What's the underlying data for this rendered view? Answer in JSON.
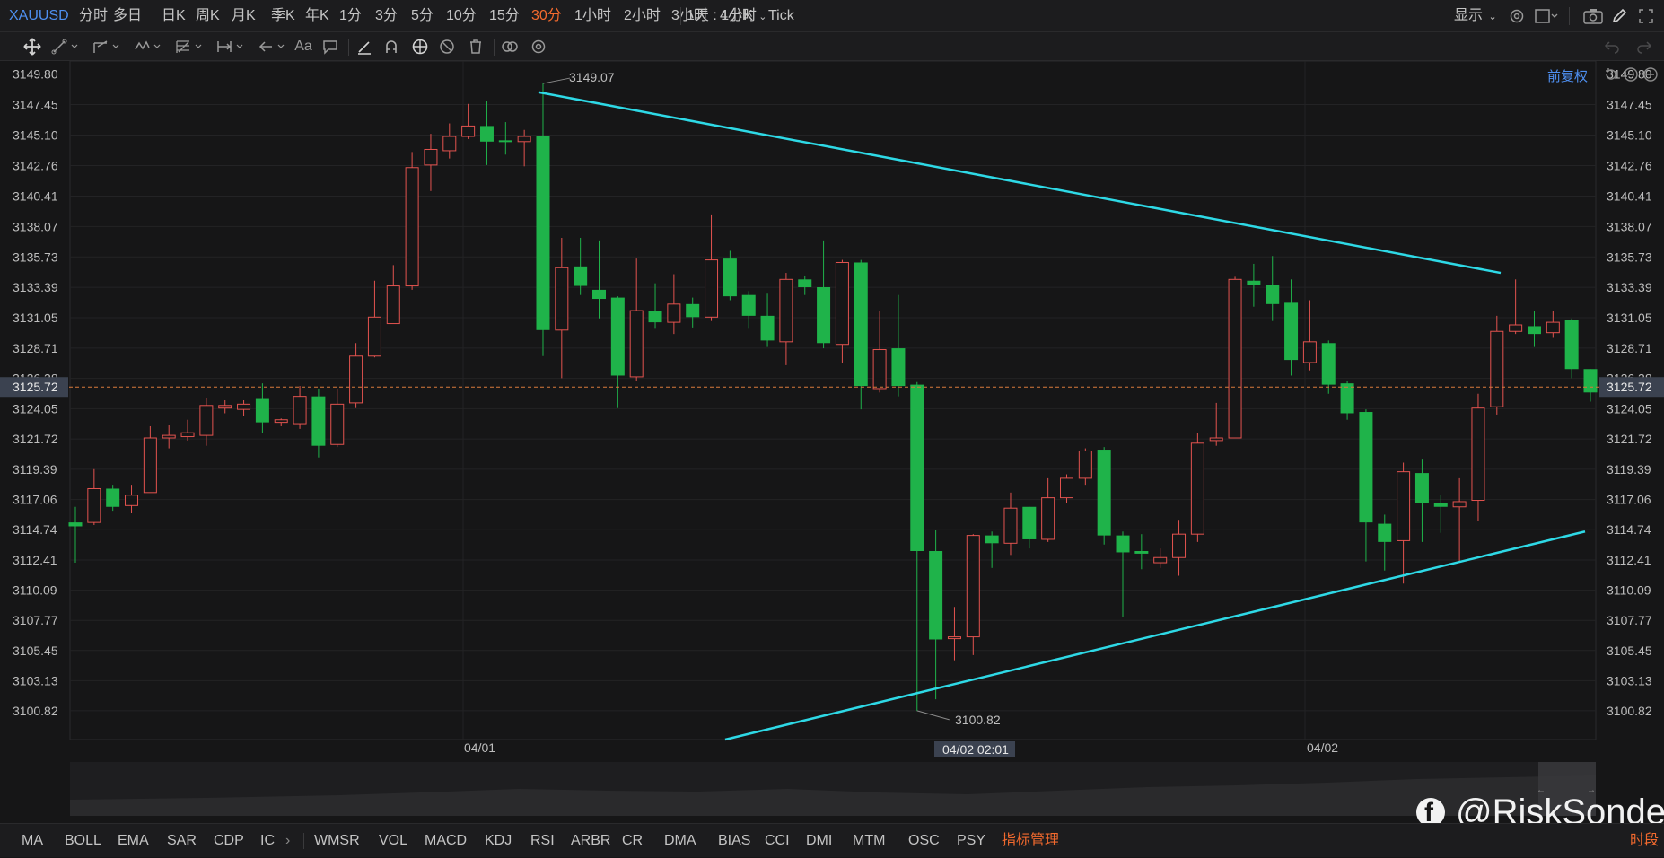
{
  "toolbar": {
    "symbol": "XAUUSD",
    "periods": [
      "分时",
      "多日",
      "日K",
      "周K",
      "月K",
      "季K",
      "年K",
      "1分",
      "3分",
      "5分",
      "10分",
      "15分",
      "30分",
      "1小时",
      "2小时",
      "3小时",
      "4小时",
      "Tick"
    ],
    "active_period": "30分",
    "combo": "1天 : 1分K",
    "display_label": "显示"
  },
  "drawing_tools": [
    "move-icon",
    "line-icon",
    "channel-icon",
    "wave-icon",
    "fib-icon",
    "measure-icon",
    "arrow-icon",
    "text-icon",
    "comment-icon",
    "pen-icon",
    "magnet-icon",
    "lock-icon",
    "hide-icon",
    "trash-icon",
    "link-icon",
    "settings-icon"
  ],
  "chart": {
    "fuquan_label": "前复权",
    "current_price_label": "3125.72"
  },
  "chart_data": {
    "type": "candlestick",
    "symbol": "XAUUSD",
    "timeframe": "30分",
    "y_ticks": [
      "3149.80",
      "3147.45",
      "3145.10",
      "3142.76",
      "3140.41",
      "3138.07",
      "3135.73",
      "3133.39",
      "3131.05",
      "3128.71",
      "3126.38",
      "3124.05",
      "3121.72",
      "3119.39",
      "3117.06",
      "3114.74",
      "3112.41",
      "3110.09",
      "3107.77",
      "3105.45",
      "3103.13",
      "3100.82"
    ],
    "ylim": [
      3098.6,
      3150.8
    ],
    "x_labels": [
      "04/01",
      "04/02"
    ],
    "crosshair_label": "04/02 02:01",
    "high_marker": "3149.07",
    "low_marker": "3100.82",
    "current_price": 3125.72,
    "candles": [
      [
        3115.3,
        3115.0,
        3116.5,
        3112.2
      ],
      [
        3115.3,
        3117.9,
        3119.4,
        3115.1
      ],
      [
        3117.9,
        3116.5,
        3118.2,
        3116.2
      ],
      [
        3116.6,
        3117.4,
        3118.2,
        3116.0
      ],
      [
        3117.6,
        3121.8,
        3122.7,
        3117.6
      ],
      [
        3121.8,
        3122.0,
        3122.8,
        3121.0
      ],
      [
        3121.9,
        3122.2,
        3123.2,
        3121.6
      ],
      [
        3122.0,
        3124.3,
        3124.9,
        3121.2
      ],
      [
        3124.1,
        3124.3,
        3124.7,
        3123.7
      ],
      [
        3124.0,
        3124.4,
        3124.7,
        3123.5
      ],
      [
        3124.8,
        3123.0,
        3126.0,
        3122.2
      ],
      [
        3123.0,
        3123.2,
        3123.3,
        3122.7
      ],
      [
        3122.9,
        3125.0,
        3125.8,
        3122.5
      ],
      [
        3125.0,
        3121.2,
        3125.6,
        3120.3
      ],
      [
        3121.3,
        3124.4,
        3125.6,
        3121.1
      ],
      [
        3124.5,
        3128.1,
        3129.1,
        3124.1
      ],
      [
        3128.1,
        3131.1,
        3133.9,
        3128.0
      ],
      [
        3130.6,
        3133.5,
        3135.1,
        3130.6
      ],
      [
        3133.5,
        3142.6,
        3143.8,
        3133.2
      ],
      [
        3142.8,
        3144.0,
        3145.2,
        3140.8
      ],
      [
        3143.9,
        3145.0,
        3146.0,
        3143.3
      ],
      [
        3145.0,
        3145.8,
        3147.5,
        3144.8
      ],
      [
        3145.8,
        3144.6,
        3147.7,
        3142.8
      ],
      [
        3144.7,
        3144.6,
        3146.1,
        3143.6
      ],
      [
        3144.6,
        3145.0,
        3145.5,
        3142.7
      ],
      [
        3145.0,
        3130.1,
        3149.1,
        3128.1
      ],
      [
        3130.1,
        3134.9,
        3137.2,
        3126.4
      ],
      [
        3135.0,
        3133.5,
        3137.2,
        3132.8
      ],
      [
        3133.2,
        3132.5,
        3137.0,
        3131.0
      ],
      [
        3132.6,
        3126.6,
        3132.7,
        3124.1
      ],
      [
        3126.5,
        3131.6,
        3135.6,
        3126.2
      ],
      [
        3131.6,
        3130.7,
        3133.7,
        3130.2
      ],
      [
        3130.7,
        3132.1,
        3134.4,
        3129.8
      ],
      [
        3132.1,
        3131.1,
        3132.6,
        3130.3
      ],
      [
        3131.1,
        3135.5,
        3139.0,
        3130.8
      ],
      [
        3135.6,
        3132.7,
        3136.2,
        3132.4
      ],
      [
        3132.8,
        3131.2,
        3133.1,
        3130.2
      ],
      [
        3131.2,
        3129.3,
        3132.9,
        3128.8
      ],
      [
        3129.2,
        3134.0,
        3134.5,
        3127.4
      ],
      [
        3134.0,
        3133.4,
        3134.3,
        3132.8
      ],
      [
        3133.4,
        3129.1,
        3137.0,
        3128.7
      ],
      [
        3129.0,
        3135.3,
        3135.5,
        3127.6
      ],
      [
        3135.3,
        3125.8,
        3135.5,
        3124.0
      ],
      [
        3125.6,
        3128.6,
        3131.6,
        3125.3
      ],
      [
        3128.7,
        3125.8,
        3132.8,
        3125.0
      ],
      [
        3125.9,
        3113.1,
        3126.1,
        3100.8
      ],
      [
        3113.1,
        3106.3,
        3114.7,
        3101.7
      ],
      [
        3106.4,
        3106.5,
        3108.8,
        3104.7
      ],
      [
        3106.5,
        3114.3,
        3114.4,
        3105.1
      ],
      [
        3114.3,
        3113.7,
        3114.6,
        3111.8
      ],
      [
        3113.7,
        3116.4,
        3117.6,
        3112.8
      ],
      [
        3116.5,
        3114.0,
        3116.5,
        3113.3
      ],
      [
        3114.0,
        3117.2,
        3118.7,
        3113.8
      ],
      [
        3117.2,
        3118.7,
        3119.0,
        3116.8
      ],
      [
        3118.7,
        3120.8,
        3121.0,
        3118.2
      ],
      [
        3120.9,
        3114.3,
        3121.1,
        3113.6
      ],
      [
        3114.3,
        3113.0,
        3114.6,
        3108.0
      ],
      [
        3113.1,
        3112.9,
        3114.4,
        3111.7
      ],
      [
        3112.2,
        3112.6,
        3113.3,
        3111.8
      ],
      [
        3112.6,
        3114.4,
        3115.5,
        3111.2
      ],
      [
        3114.4,
        3121.4,
        3122.2,
        3113.8
      ],
      [
        3121.6,
        3121.8,
        3124.5,
        3121.2
      ],
      [
        3121.8,
        3134.0,
        3134.2,
        3121.8
      ],
      [
        3133.9,
        3133.6,
        3135.2,
        3131.9
      ],
      [
        3133.6,
        3132.1,
        3135.8,
        3130.8
      ],
      [
        3132.2,
        3127.8,
        3134.0,
        3126.6
      ],
      [
        3127.6,
        3129.2,
        3132.4,
        3127.0
      ],
      [
        3129.1,
        3125.9,
        3129.3,
        3125.2
      ],
      [
        3126.0,
        3123.7,
        3126.2,
        3123.2
      ],
      [
        3123.8,
        3115.3,
        3124.0,
        3112.3
      ],
      [
        3115.2,
        3113.8,
        3115.9,
        3111.6
      ],
      [
        3113.9,
        3119.2,
        3119.9,
        3110.6
      ],
      [
        3119.1,
        3116.8,
        3120.2,
        3113.8
      ],
      [
        3116.8,
        3116.5,
        3117.4,
        3114.5
      ],
      [
        3116.5,
        3116.9,
        3118.7,
        3112.3
      ],
      [
        3117.0,
        3124.1,
        3125.2,
        3115.4
      ],
      [
        3124.2,
        3130.0,
        3131.2,
        3123.6
      ],
      [
        3130.0,
        3130.5,
        3134.0,
        3129.8
      ],
      [
        3130.4,
        3129.8,
        3131.6,
        3128.8
      ],
      [
        3129.9,
        3130.7,
        3131.6,
        3129.5
      ],
      [
        3130.9,
        3127.1,
        3131.0,
        3126.4
      ],
      [
        3127.1,
        3125.3,
        3127.1,
        3124.6
      ]
    ],
    "trendlines": [
      {
        "name": "upper",
        "from": [
          0,
          3148.4
        ],
        "to": [
          1,
          3134.5
        ]
      },
      {
        "name": "lower",
        "from": [
          0,
          3098.6
        ],
        "to": [
          1,
          3114.6
        ]
      }
    ],
    "colors": {
      "up": "#e3534f",
      "down": "#1fb34a",
      "trend": "#2ed9e6",
      "price_line": "#d97a3b",
      "grid": "#232325",
      "axis_text": "#bdbdbd",
      "bg": "#161617"
    }
  },
  "indicators": {
    "list": [
      "MA",
      "BOLL",
      "EMA",
      "SAR",
      "CDP",
      "IC",
      "WMSR",
      "VOL",
      "MACD",
      "KDJ",
      "RSI",
      "ARBR",
      "CR",
      "DMA",
      "BIAS",
      "CCI",
      "DMI",
      "MTM",
      "OSC",
      "PSY"
    ],
    "manager_label": "指标管理",
    "period_label": "时段"
  },
  "watermark": {
    "text": "@RiskSonder"
  }
}
